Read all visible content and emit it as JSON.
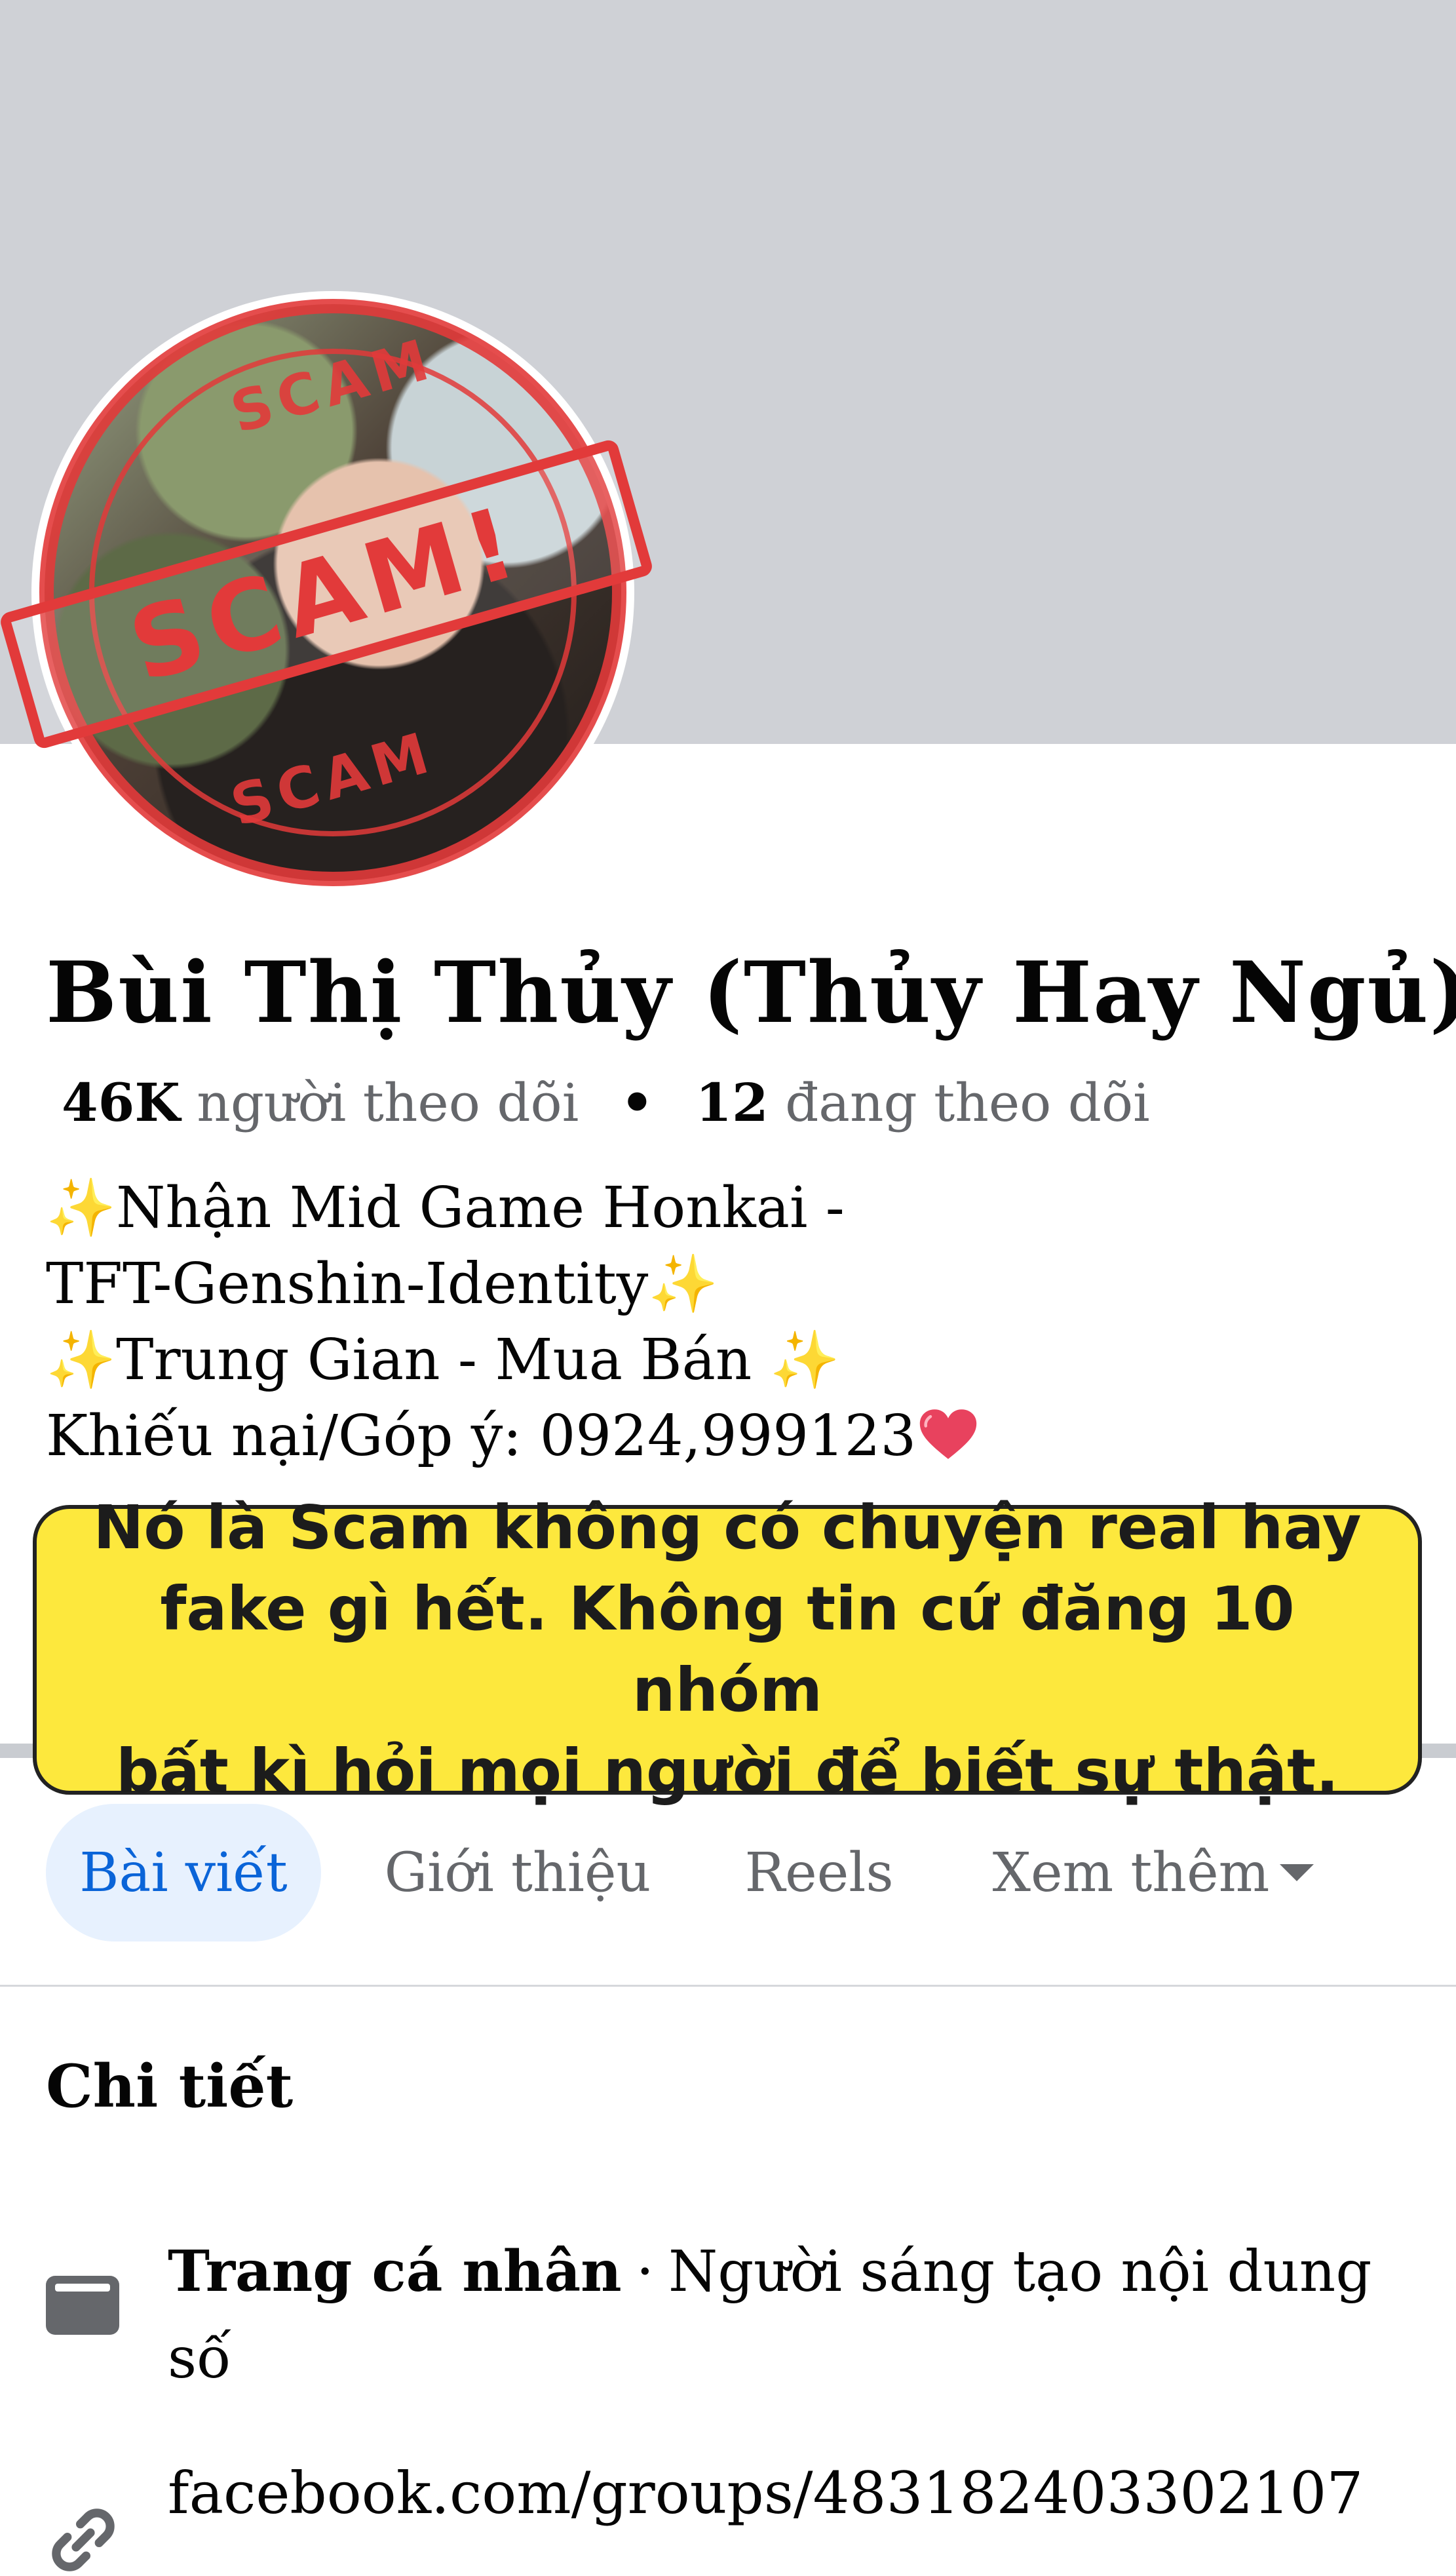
{
  "profile": {
    "name": "Bùi Thị Thủy (Thủy Hay Ngủ)",
    "followers_count": "46K",
    "followers_label": "người theo dõi",
    "separator": "•",
    "following_count": "12",
    "following_label": "đang theo dõi"
  },
  "stamp": {
    "top": "SCAM",
    "banner": "SCAM!",
    "bottom": "SCAM"
  },
  "bio": {
    "line1": "✨Nhận Mid Game Honkai -",
    "line2": "TFT-Genshin-Identity✨",
    "line3": "✨Trung Gian - Mua Bán ✨",
    "line4": "Khiếu nại/Góp ý: 0924,999123"
  },
  "overlay_note": {
    "line1": "Nó là Scam không có chuyện real hay",
    "line2": "fake gì hết. Không tin cứ đăng 10 nhóm",
    "line3": "bất kì hỏi mọi người để biết sự thật."
  },
  "tabs": [
    {
      "label": "Bài viết",
      "active": true
    },
    {
      "label": "Giới thiệu",
      "active": false
    },
    {
      "label": "Reels",
      "active": false
    },
    {
      "label": "Xem thêm",
      "active": false
    }
  ],
  "details": {
    "title": "Chi tiết",
    "category_strong": "Trang cá nhân",
    "category_dot": "·",
    "category_text": "Người sáng tạo nội dung",
    "category_text_cont": "số",
    "link": "facebook.com/groups/483182403302107"
  },
  "colors": {
    "cover": "#cfd1d6",
    "stamp_red": "#e23a3a",
    "note_yellow": "#fde83d",
    "tab_active_bg": "#e7f1fe",
    "tab_active_text": "#0a64d8"
  }
}
